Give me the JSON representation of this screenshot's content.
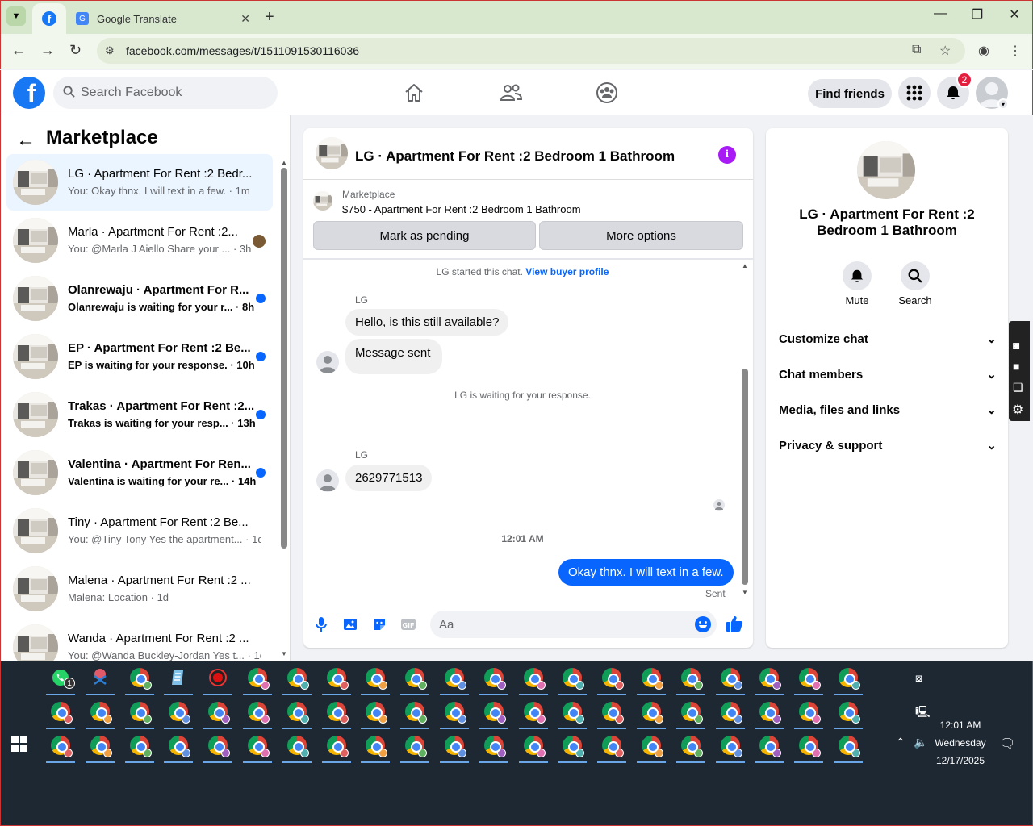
{
  "browser": {
    "tabs": [
      {
        "label": "",
        "icon": "facebook-icon"
      },
      {
        "label": "Google Translate",
        "icon": "google-translate-icon"
      }
    ],
    "url": "facebook.com/messages/t/1511091530116036"
  },
  "header": {
    "search_placeholder": "Search Facebook",
    "find_friends": "Find friends",
    "notification_count": "2"
  },
  "marketplace": {
    "title": "Marketplace",
    "conversations": [
      {
        "title": "LG · Apartment For Rent :2 Bedr...",
        "snippet": "You: Okay thnx. I will text in a few.",
        "time": "1m",
        "unread": false
      },
      {
        "title": "Marla · Apartment For Rent :2...",
        "snippet": "You: @Marla J Aiello Share your ...",
        "time": "3h",
        "unread": false
      },
      {
        "title": "Olanrewaju · Apartment For R...",
        "snippet": "Olanrewaju is waiting for your r...",
        "time": "8h",
        "unread": true
      },
      {
        "title": "EP · Apartment For Rent :2 Be...",
        "snippet": "EP is waiting for your response.",
        "time": "10h",
        "unread": true
      },
      {
        "title": "Trakas · Apartment For Rent :2...",
        "snippet": "Trakas is waiting for your resp...",
        "time": "13h",
        "unread": true
      },
      {
        "title": "Valentina · Apartment For Ren...",
        "snippet": "Valentina is waiting for your re...",
        "time": "14h",
        "unread": true
      },
      {
        "title": "Tiny · Apartment For Rent :2 Be...",
        "snippet": "You: @Tiny Tony Yes the apartment...",
        "time": "1d",
        "unread": false
      },
      {
        "title": "Malena · Apartment For Rent :2 ...",
        "snippet": "Malena: Location",
        "time": "1d",
        "unread": false
      },
      {
        "title": "Wanda · Apartment For Rent :2 ...",
        "snippet": "You: @Wanda Buckley-Jordan Yes t...",
        "time": "1d",
        "unread": false
      }
    ]
  },
  "chat": {
    "title": "LG · Apartment For Rent :2 Bedroom 1 Bathroom",
    "marketplace_label": "Marketplace",
    "listing": "$750 - Apartment For Rent :2 Bedroom 1 Bathroom",
    "mark_pending": "Mark as pending",
    "more_options": "More options",
    "started": "LG started this chat.",
    "view_profile": "View buyer profile",
    "sender": "LG",
    "msg1": "Hello, is this still available?",
    "msg2": "Message sent",
    "waiting": "LG is waiting for your response.",
    "msg3": "2629771513",
    "timestamp": "12:01 AM",
    "my_msg": "Okay thnx. I will text in a few.",
    "status": "Sent",
    "composer_placeholder": "Aa"
  },
  "details": {
    "title": "LG · Apartment For Rent :2 Bedroom 1 Bathroom",
    "mute": "Mute",
    "search": "Search",
    "rows": [
      "Customize chat",
      "Chat members",
      "Media, files and links",
      "Privacy & support"
    ]
  },
  "taskbar": {
    "time": "12:01 AM",
    "day": "Wednesday",
    "date": "12/17/2025",
    "whatsapp_badge": "1"
  },
  "colors": {
    "fb_blue": "#1877f2",
    "messenger_blue": "#0866ff",
    "info_purple": "#a81bf5",
    "notif_red": "#e41e3f"
  }
}
